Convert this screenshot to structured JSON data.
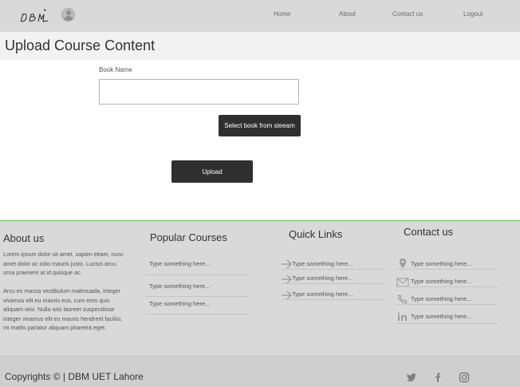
{
  "header": {
    "logo_text": "DBM",
    "nav": [
      "Home",
      "About",
      "Contact us",
      "Logout"
    ]
  },
  "page": {
    "title": "Upload Course Content"
  },
  "form": {
    "book_name_label": "Book Name",
    "book_name_value": "",
    "select_button": "Select book from steeam",
    "upload_button": "Upload"
  },
  "footer": {
    "about": {
      "heading": "About us",
      "para1": "Lorem ipsum dolor sit amet, sapien etiam, nunc amet dolor ac odio mauris justo. Luctus arcu, urna praesent at id quisque ac.",
      "para2": "Arcu es massa vestibulum malesuada, integer vivamus elit eu mauris eus, cum eros quis aliquam wisi. Nulla wisi laoreet suspendisse integer vivamus elit eu mauris hendrerit facilisi, mi mattis pariatur aliquam pharetra eget."
    },
    "courses": {
      "heading": "Popular Courses",
      "items": [
        "Type something here...",
        "Type something here...",
        "Type something here..."
      ]
    },
    "links": {
      "heading": "Quick Links",
      "items": [
        "Type something here...",
        "Type something here...",
        "Type something here..."
      ]
    },
    "contact": {
      "heading": "Contact us",
      "items": [
        "Type something here...",
        "Type something here...",
        "Type something here...",
        "Type something here..."
      ]
    },
    "copyright": "Copyrights © | DBM UET Lahore"
  },
  "colors": {
    "nav_bg": "#d9d9d9",
    "button_dark": "#2f2f2f",
    "footer_accent": "#5bc45b"
  }
}
